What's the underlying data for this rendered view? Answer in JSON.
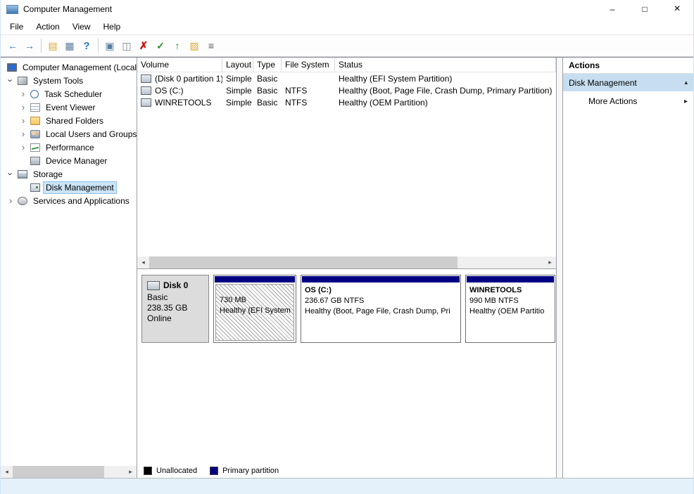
{
  "window": {
    "title": "Computer Management",
    "controls": {
      "minimize": "–",
      "maximize": "□",
      "close": "×"
    }
  },
  "menu": {
    "items": [
      "File",
      "Action",
      "View",
      "Help"
    ]
  },
  "toolbar": {
    "icons": [
      {
        "name": "back-icon",
        "glyph": "←"
      },
      {
        "name": "forward-icon",
        "glyph": "→"
      },
      {
        "name": "export-list-icon",
        "glyph": "▤"
      },
      {
        "name": "show-console-tree-icon",
        "glyph": "▦"
      },
      {
        "name": "help-icon",
        "glyph": "?"
      },
      {
        "name": "window-icon",
        "glyph": "▣"
      },
      {
        "name": "comment-icon",
        "glyph": "◫"
      },
      {
        "name": "delete-volume-icon",
        "glyph": "✗"
      },
      {
        "name": "check-disk-icon",
        "glyph": "✓"
      },
      {
        "name": "up-one-level-icon",
        "glyph": "↑"
      },
      {
        "name": "open-folder-icon",
        "glyph": "▨"
      },
      {
        "name": "properties-icon",
        "glyph": "≡"
      }
    ]
  },
  "tree": {
    "items": [
      {
        "label": "Computer Management (Local)",
        "icon": "computer",
        "exp": "none"
      },
      {
        "label": "System Tools",
        "icon": "tools",
        "exp": "open"
      },
      {
        "label": "Task Scheduler",
        "icon": "task-scheduler",
        "exp": "closed"
      },
      {
        "label": "Event Viewer",
        "icon": "event-viewer",
        "exp": "closed"
      },
      {
        "label": "Shared Folders",
        "icon": "shared-folders",
        "exp": "closed"
      },
      {
        "label": "Local Users and Groups",
        "icon": "users",
        "exp": "closed"
      },
      {
        "label": "Performance",
        "icon": "performance",
        "exp": "closed"
      },
      {
        "label": "Device Manager",
        "icon": "device-manager",
        "exp": "none"
      },
      {
        "label": "Storage",
        "icon": "storage",
        "exp": "open"
      },
      {
        "label": "Disk Management",
        "icon": "disk-management",
        "exp": "none"
      },
      {
        "label": "Services and Applications",
        "icon": "services",
        "exp": "closed"
      }
    ]
  },
  "volume_table": {
    "columns": [
      "Volume",
      "Layout",
      "Type",
      "File System",
      "Status"
    ],
    "rows": [
      {
        "volume": "(Disk 0 partition 1)",
        "layout": "Simple",
        "type": "Basic",
        "file_system": "",
        "status": "Healthy (EFI System Partition)"
      },
      {
        "volume": "OS (C:)",
        "layout": "Simple",
        "type": "Basic",
        "file_system": "NTFS",
        "status": "Healthy (Boot, Page File, Crash Dump, Primary Partition)"
      },
      {
        "volume": "WINRETOOLS",
        "layout": "Simple",
        "type": "Basic",
        "file_system": "NTFS",
        "status": "Healthy (OEM Partition)"
      }
    ]
  },
  "disk_view": {
    "disk": {
      "name": "Disk 0",
      "type": "Basic",
      "size": "238.35 GB",
      "status": "Online"
    },
    "partition_color": "#000082",
    "partitions": [
      {
        "name": "",
        "size": "730 MB",
        "status": "Healthy (EFI System",
        "hatched": true
      },
      {
        "name": "OS  (C:)",
        "size": "236.67 GB NTFS",
        "status": "Healthy (Boot, Page File, Crash Dump, Pri",
        "hatched": false
      },
      {
        "name": "WINRETOOLS",
        "size": "990 MB NTFS",
        "status": "Healthy (OEM Partitio",
        "hatched": false
      }
    ]
  },
  "legend": {
    "items": [
      {
        "label": "Unallocated",
        "color": "#000000"
      },
      {
        "label": "Primary partition",
        "color": "#000082"
      }
    ]
  },
  "actions": {
    "title": "Actions",
    "panel_title": "Disk Management",
    "more_label": "More Actions"
  }
}
